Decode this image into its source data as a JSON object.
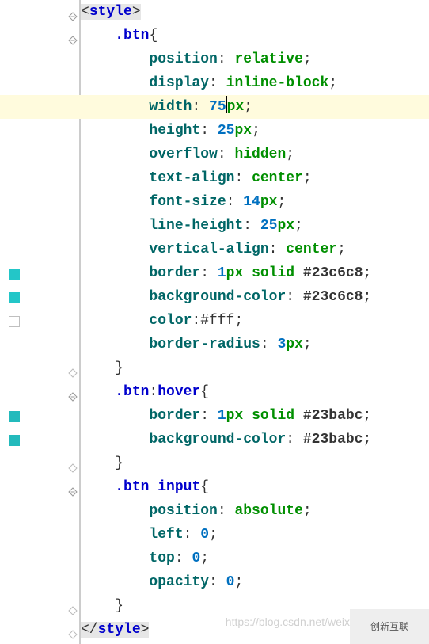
{
  "colors": {
    "teal": "#1abc9c",
    "teal2": "#17a689",
    "swatch_empty_border": "#bfbfbf"
  },
  "lines": [
    {
      "fold": "minus",
      "swatch": null,
      "html": "<span class='hl-tag-style'><span class='punct'>&lt;</span><span class='tag'>style</span><span class='punct'>&gt;</span></span>"
    },
    {
      "fold": "minus",
      "swatch": null,
      "html": "    <span class='sel'>.btn</span><span class='punct'>{</span>"
    },
    {
      "fold": null,
      "swatch": null,
      "html": "        <span class='prop'>position</span><span class='punct'>: </span><span class='val'>relative</span><span class='punct'>;</span>"
    },
    {
      "fold": null,
      "swatch": null,
      "html": "        <span class='prop'>display</span><span class='punct'>: </span><span class='val'>inline-block</span><span class='punct'>;</span>"
    },
    {
      "fold": null,
      "swatch": null,
      "current": true,
      "html": "        <span class='prop'>width</span><span class='punct'>: </span><span class='num'>75</span><span class='caret'></span><span class='unit'>px</span><span class='punct'>;</span>"
    },
    {
      "fold": null,
      "swatch": null,
      "html": "        <span class='prop'>height</span><span class='punct'>: </span><span class='num'>25</span><span class='unit'>px</span><span class='punct'>;</span>"
    },
    {
      "fold": null,
      "swatch": null,
      "html": "        <span class='prop'>overflow</span><span class='punct'>: </span><span class='val'>hidden</span><span class='punct'>;</span>"
    },
    {
      "fold": null,
      "swatch": null,
      "html": "        <span class='prop'>text-align</span><span class='punct'>: </span><span class='val'>center</span><span class='punct'>;</span>"
    },
    {
      "fold": null,
      "swatch": null,
      "html": "        <span class='prop'>font-size</span><span class='punct'>: </span><span class='num'>14</span><span class='unit'>px</span><span class='punct'>;</span>"
    },
    {
      "fold": null,
      "swatch": null,
      "html": "        <span class='prop'>line-height</span><span class='punct'>: </span><span class='num'>25</span><span class='unit'>px</span><span class='punct'>;</span>"
    },
    {
      "fold": null,
      "swatch": null,
      "html": "        <span class='prop'>vertical-align</span><span class='punct'>: </span><span class='val'>center</span><span class='punct'>;</span>"
    },
    {
      "fold": null,
      "swatch": "#23c6c8",
      "html": "        <span class='prop'>border</span><span class='punct'>: </span><span class='num'>1</span><span class='unit'>px</span> <span class='val'>solid</span> <span class='hexc'>#23c6c8</span><span class='punct'>;</span>"
    },
    {
      "fold": null,
      "swatch": "#23c6c8",
      "html": "        <span class='prop'>background-color</span><span class='punct'>: </span><span class='hexc'>#23c6c8</span><span class='punct'>;</span>"
    },
    {
      "fold": null,
      "swatch": "empty",
      "html": "        <span class='prop'>color</span><span class='punct'>:</span><span class='colorw'>#fff</span><span class='punct'>;</span>"
    },
    {
      "fold": null,
      "swatch": null,
      "html": "        <span class='prop'>border-radius</span><span class='punct'>: </span><span class='num'>3</span><span class='unit'>px</span><span class='punct'>;</span>"
    },
    {
      "fold": "end",
      "swatch": null,
      "html": "    <span class='punct'>}</span>"
    },
    {
      "fold": "minus",
      "swatch": null,
      "html": "    <span class='sel'>.btn</span><span class='punct'>:</span><span class='sel'>hover</span><span class='punct'>{</span>"
    },
    {
      "fold": null,
      "swatch": "#23babc",
      "html": "        <span class='prop'>border</span><span class='punct'>: </span><span class='num'>1</span><span class='unit'>px</span> <span class='val'>solid</span> <span class='hexc'>#23babc</span><span class='punct'>;</span>"
    },
    {
      "fold": null,
      "swatch": "#23babc",
      "html": "        <span class='prop'>background-color</span><span class='punct'>: </span><span class='hexc'>#23babc</span><span class='punct'>;</span>"
    },
    {
      "fold": "end",
      "swatch": null,
      "html": "    <span class='punct'>}</span>"
    },
    {
      "fold": "minus",
      "swatch": null,
      "html": "    <span class='sel'>.btn</span> <span class='sel'>input</span><span class='punct'>{</span>"
    },
    {
      "fold": null,
      "swatch": null,
      "html": "        <span class='prop'>position</span><span class='punct'>: </span><span class='val'>absolute</span><span class='punct'>;</span>"
    },
    {
      "fold": null,
      "swatch": null,
      "html": "        <span class='prop'>left</span><span class='punct'>: </span><span class='num'>0</span><span class='punct'>;</span>"
    },
    {
      "fold": null,
      "swatch": null,
      "html": "        <span class='prop'>top</span><span class='punct'>: </span><span class='num'>0</span><span class='punct'>;</span>"
    },
    {
      "fold": null,
      "swatch": null,
      "html": "        <span class='prop'>opacity</span><span class='punct'>: </span><span class='num'>0</span><span class='punct'>;</span>"
    },
    {
      "fold": "end",
      "swatch": null,
      "html": "    <span class='punct'>}</span>"
    },
    {
      "fold": "end",
      "swatch": null,
      "html": "<span class='hl-tag-style'><span class='punct'>&lt;/</span><span class='tag'>style</span><span class='punct'>&gt;</span></span>"
    }
  ],
  "watermark": "https://blog.csdn.net/weix",
  "logo_text": "创新互联"
}
